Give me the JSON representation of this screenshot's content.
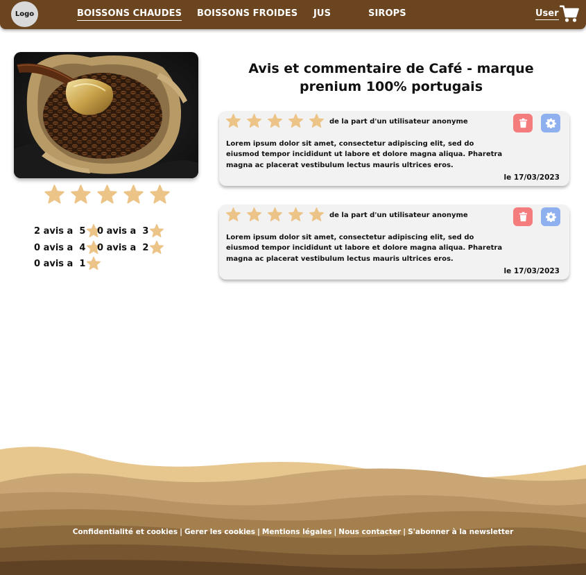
{
  "header": {
    "logo": "Logo",
    "nav": [
      {
        "label": "BOISSONS CHAUDES",
        "active": true
      },
      {
        "label": "BOISSONS FROIDES",
        "active": false
      },
      {
        "label": "JUS",
        "active": false
      },
      {
        "label": "SIROPS",
        "active": false
      }
    ],
    "user": "User",
    "cart_icon": "cart-icon"
  },
  "product": {
    "title": "Avis et commentaire de Café - marque prenium 100% portugais",
    "rating": {
      "value": 5,
      "max": 5
    },
    "distribution": [
      {
        "label": "2 avis a  5"
      },
      {
        "label": "0 avis a  3"
      },
      {
        "label": "0 avis a  4"
      },
      {
        "label": "0 avis a  2"
      },
      {
        "label": "0 avis a  1"
      }
    ]
  },
  "reviews": [
    {
      "stars": 5,
      "author": "de la part d'un utilisateur anonyme",
      "text": "Lorem ipsum dolor sit amet, consectetur adipiscing elit, sed do eiusmod tempor incididunt ut labore et dolore magna aliqua. Pharetra magna ac placerat vestibulum lectus mauris ultrices eros.",
      "date": "le 17/03/2023"
    },
    {
      "stars": 5,
      "author": "de la part d'un utilisateur anonyme",
      "text": "Lorem ipsum dolor sit amet, consectetur adipiscing elit, sed do eiusmod tempor incididunt ut labore et dolore magna aliqua. Pharetra magna ac placerat vestibulum lectus mauris ultrices eros.",
      "date": "le 17/03/2023"
    }
  ],
  "footer": {
    "links": [
      "Confidentialité et cookies",
      "Gerer les cookies",
      "Mentions légales",
      "Nous contacter",
      "S'abonner à la newsletter"
    ],
    "separator": "|"
  },
  "colors": {
    "navbar": "#6b4520",
    "star": "#ecc488",
    "delete_button": "#f47c7c",
    "settings_button": "#8fb0ee",
    "card": "#f2f2f2"
  }
}
